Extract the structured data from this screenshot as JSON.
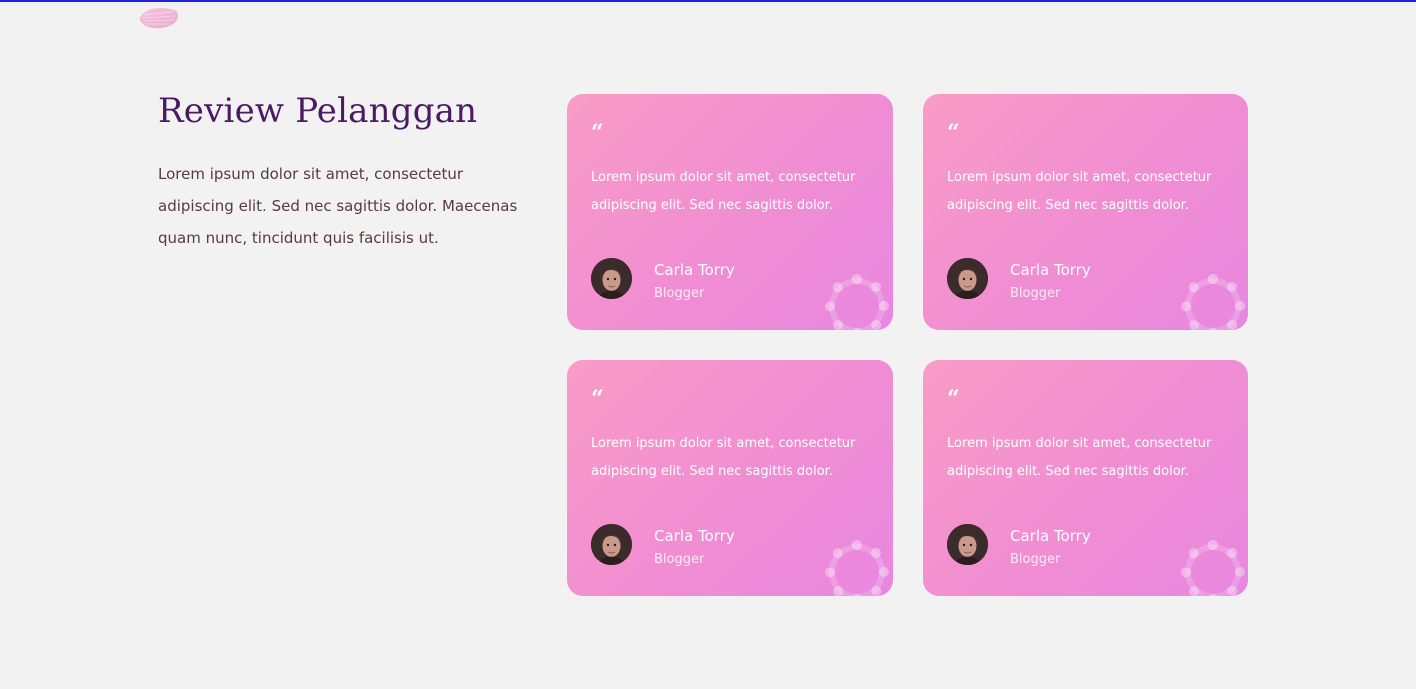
{
  "header": {
    "decoration_icon": "brush-stroke-icon"
  },
  "section": {
    "title": "Review Pelanggan",
    "description": "Lorem ipsum dolor sit amet, consectetur adipiscing elit. Sed nec sagittis dolor. Maecenas quam nunc, tincidunt quis facilisis ut."
  },
  "reviews": [
    {
      "quote_mark": "“",
      "text": "Lorem ipsum dolor sit amet, consectetur adipiscing elit. Sed nec sagittis dolor.",
      "author": "Carla Torry",
      "role": "Blogger"
    },
    {
      "quote_mark": "“",
      "text": "Lorem ipsum dolor sit amet, consectetur adipiscing elit. Sed nec sagittis dolor.",
      "author": "Carla Torry",
      "role": "Blogger"
    },
    {
      "quote_mark": "“",
      "text": "Lorem ipsum dolor sit amet, consectetur adipiscing elit. Sed nec sagittis dolor.",
      "author": "Carla Torry",
      "role": "Blogger"
    },
    {
      "quote_mark": "“",
      "text": "Lorem ipsum dolor sit amet, consectetur adipiscing elit. Sed nec sagittis dolor.",
      "author": "Carla Torry",
      "role": "Blogger"
    }
  ],
  "colors": {
    "title": "#4a1a63",
    "body_text": "#5b3a3a",
    "card_gradient_start": "#f99cc6",
    "card_gradient_end": "#e887e0",
    "top_line": "#1f1fe6",
    "background": "#f2f2f2"
  }
}
